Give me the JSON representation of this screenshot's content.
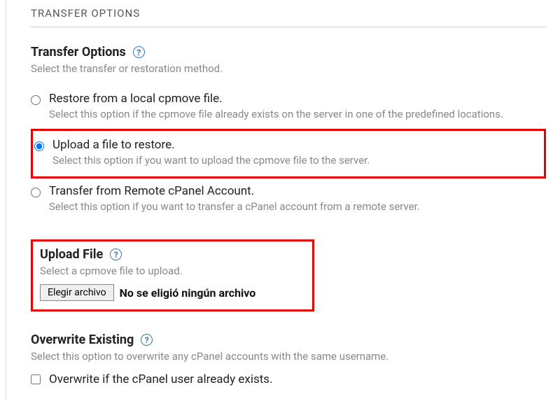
{
  "section_title": "TRANSFER OPTIONS",
  "transfer": {
    "heading": "Transfer Options",
    "subtext": "Select the transfer or restoration method.",
    "options": [
      {
        "label": "Restore from a local cpmove file.",
        "desc": "Select this option if the cpmove file already exists on the server in one of the predefined locations."
      },
      {
        "label": "Upload a file to restore.",
        "desc": "Select this option if you want to upload the cpmove file to the server."
      },
      {
        "label": "Transfer from Remote cPanel Account.",
        "desc": "Select this option if you want to transfer a cPanel account from a remote server."
      }
    ]
  },
  "upload": {
    "heading": "Upload File",
    "subtext": "Select a cpmove file to upload.",
    "button_label": "Elegir archivo",
    "status_text": "No se eligió ningún archivo"
  },
  "overwrite": {
    "heading": "Overwrite Existing",
    "subtext": "Select this option to overwrite any cPanel accounts with the same username.",
    "checkbox_label": "Overwrite if the cPanel user already exists."
  },
  "help_glyph": "?"
}
